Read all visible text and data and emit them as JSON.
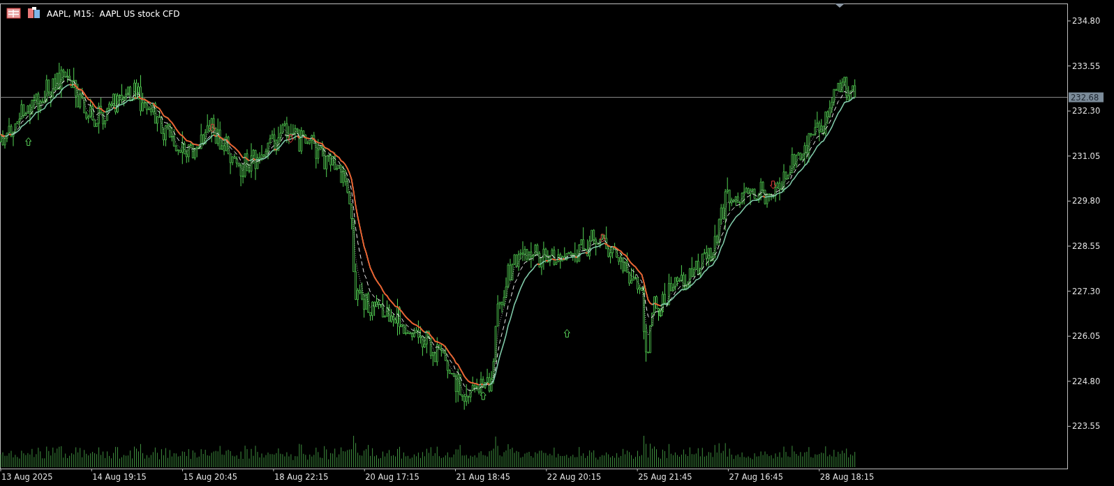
{
  "chart": {
    "title": "AAPL, M15:  AAPL US stock CFD",
    "price_axis": [
      "234.80",
      "233.55",
      "232.30",
      "231.05",
      "229.80",
      "228.55",
      "227.30",
      "226.05",
      "224.80",
      "223.55"
    ],
    "current_price": "232.68",
    "time_axis": [
      "13 Aug 2025",
      "14 Aug 19:15",
      "15 Aug 20:45",
      "18 Aug 22:15",
      "20 Aug 17:15",
      "21 Aug 18:45",
      "22 Aug 20:15",
      "25 Aug 21:45",
      "27 Aug 16:45",
      "28 Aug 18:15"
    ]
  }
}
